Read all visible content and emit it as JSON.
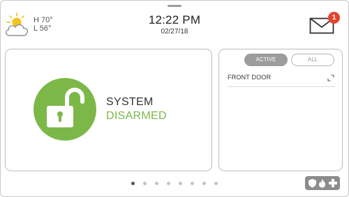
{
  "weather": {
    "high": "H 70°",
    "low": "L 56°",
    "icon": "partly-cloudy-icon"
  },
  "clock": {
    "time": "12:22 PM",
    "date": "02/27/18"
  },
  "messages": {
    "icon": "envelope-icon",
    "unread_count": "1"
  },
  "security": {
    "status_line1": "SYSTEM",
    "status_line2": "DISARMED",
    "icon": "unlocked-padlock-icon",
    "status_color": "#7cb848"
  },
  "sensors": {
    "tabs": [
      {
        "label": "ACTIVE",
        "selected": true
      },
      {
        "label": "ALL",
        "selected": false
      }
    ],
    "items": [
      {
        "name": "FRONT DOOR",
        "status_icon": "door-open-icon"
      }
    ]
  },
  "pager": {
    "pages": 8,
    "current": 1
  },
  "emergency": {
    "icons": [
      "shield-icon",
      "fire-icon",
      "medical-cross-icon"
    ],
    "color": "#8c8c8c"
  },
  "colors": {
    "accent_green": "#7cb848",
    "badge_red": "#e2452b"
  }
}
